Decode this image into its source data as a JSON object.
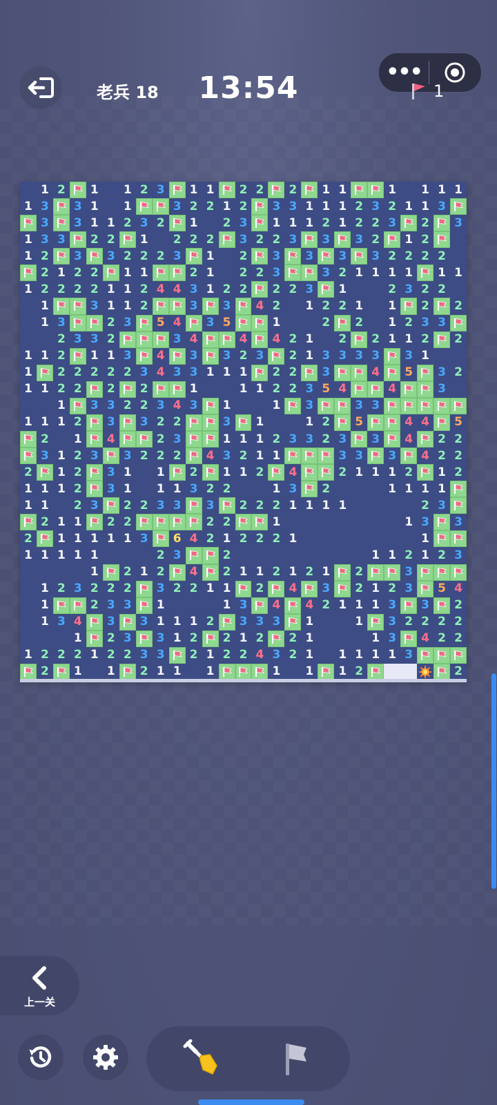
{
  "header": {
    "level_label": "老兵 18",
    "timer": "13:54",
    "menu_dots": "•••",
    "flags_remaining": "1"
  },
  "board": {
    "cols": 27,
    "rows": 30,
    "legend": "digits = adjacent mine count, F = flag, . = revealed empty, H = hidden, B = exploded mine",
    "grid": [
      ".12F1.123F11F22F2F11FF1.111",
      "13F31.1FF32212F33111232113F2",
      "F3F311232F1.23F11121223F2F3",
      "133F22F1.222F3223F3F32F12F",
      "12F3F32223F1.2F3F3F3F32222",
      "F2122F11FF21.223FF321111F11F",
      "12222112443122F223F1..2322",
      ".1FF3112FF3F3F42.1221.1F2F2",
      ".13FF23F54F35FF1..2F2.1233F",
      "..2332FFF34FF4F421.2F2112F21",
      "112F113F4F3F323F213333F31",
      "1F222223433111F22F3FF4F5F321",
      "1122F2F2FF1..1122354FF4FF3",
      "..1F3322343F1..1F3FF33FFFFF",
      "1112F3F322FF3F1..12F5FF44F5FF",
      "F2.1F4FF23FF11123323F3F4F2233",
      "F3123F3222F43211FFF33F3F4221F1",
      "2F12F31.1F2F112F4FF21112F1222",
      "1112F31.11322..13F2...1111F2",
      "11.23F2233F3F2221111....23F",
      "F211F22FFFF22FF1.......13F3",
      "2F111113F64212221.......1FF4",
      "11111...23FF2........112123F5FF",
      "....1F212F4F2112121F2FF3FFF5F",
      ".123222F32211F2F4F3F2123F54F2",
      ".1FF233F1...13F4F421113F3F21",
      ".134F3F31112F333F1..1F32222221",
      "...1F23F312F212F21...13F4223F2",
      "122212233F21224321.11113FFF5F3",
      "F2F1.1F211.1FFF1.1F12FHHBF2"
    ]
  },
  "controls": {
    "prev_level_label": "上一关",
    "restart_icon": "restart-icon",
    "settings_icon": "gear-icon",
    "dig_icon": "shovel-icon",
    "flag_icon": "flag-icon"
  },
  "colors": {
    "background": "#4f5478",
    "board": "#3d4c84",
    "flag_cell": "#8fd88f",
    "num1": "#f3f5ff",
    "num2": "#8ff0b8",
    "num3": "#4aa8ff",
    "num4": "#ff6f8c",
    "num5": "#ffa95e",
    "num6": "#ffe06a",
    "accent": "#3c8cf0"
  }
}
